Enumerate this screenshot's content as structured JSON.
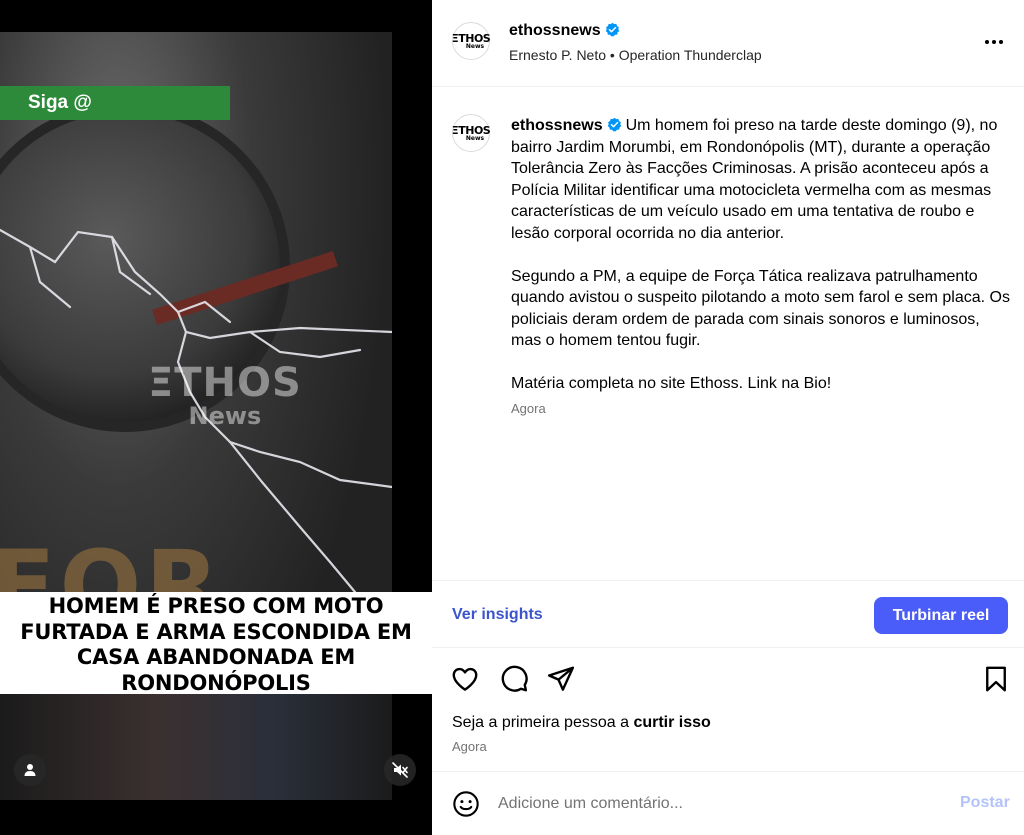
{
  "media": {
    "banner": "Siga @",
    "watermark_line1": "ΞTHOS",
    "watermark_line2": "News",
    "headline": "HOMEM É PRESO COM MOTO\nFURTADA E ARMA ESCONDIDA EM\nCASA ABANDONADA EM\nRONDONÓPOLIS",
    "icons": [
      "user-icon",
      "mute-icon"
    ]
  },
  "header": {
    "avatar_line1": "ΞTHOS",
    "avatar_line2": "News",
    "username": "ethossnews",
    "subline": "Ernesto P. Neto • Operation Thunderclap"
  },
  "caption": {
    "username": "ethossnews",
    "paragraph1": "Um homem foi preso na tarde deste domingo (9), no bairro Jardim Morumbi, em Rondonópolis (MT), durante a operação Tolerância Zero às Facções Criminosas. A prisão aconteceu após a Polícia Militar identificar uma motocicleta vermelha com as mesmas características de um veículo usado em uma tentativa de roubo e lesão corporal ocorrida no dia anterior.",
    "paragraph2": "Segundo a PM, a equipe de Força Tática realizava patrulhamento quando avistou o suspeito pilotando a moto sem farol e sem placa. Os policiais deram ordem de parada com sinais sonoros e luminosos, mas o homem tentou fugir.",
    "paragraph3": "Matéria completa no site Ethoss. Link na Bio!",
    "time": "Agora"
  },
  "insights": {
    "link_label": "Ver insights",
    "boost_label": "Turbinar reel"
  },
  "actions": {
    "icons": [
      "heart-icon",
      "comment-icon",
      "share-icon",
      "bookmark-icon"
    ]
  },
  "likes": {
    "prefix": "Seja a primeira pessoa a",
    "action": "curtir isso",
    "time": "Agora"
  },
  "comment": {
    "placeholder": "Adicione um comentário...",
    "post_label": "Postar"
  },
  "colors": {
    "accent": "#4a5df9",
    "link": "#3b55cc",
    "verified": "#0095f6",
    "banner_green": "#2d8a3a"
  }
}
